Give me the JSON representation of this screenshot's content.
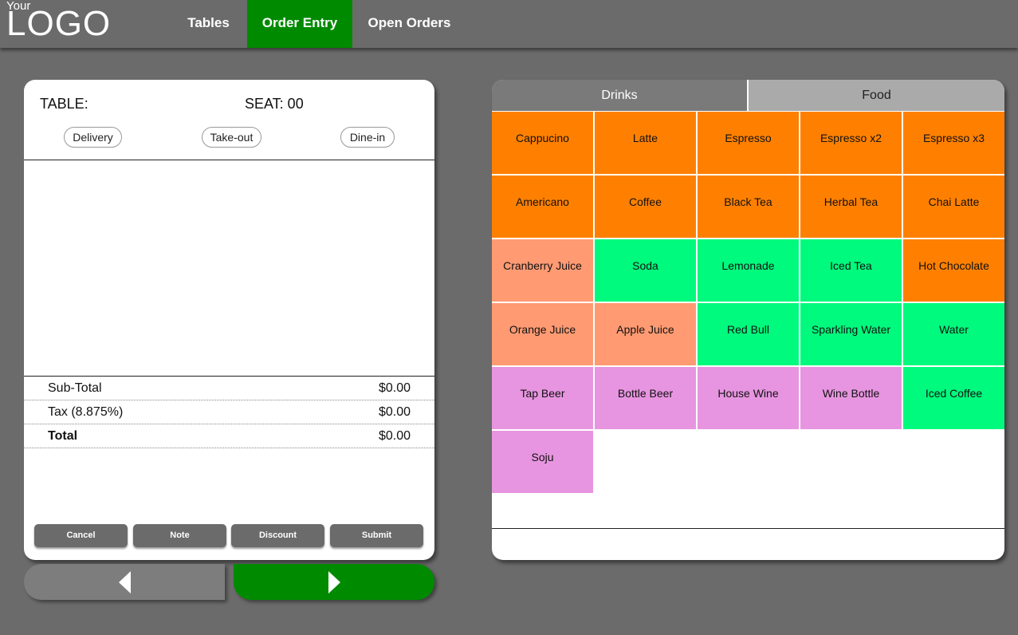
{
  "header": {
    "logo_small": "Your",
    "logo_big": "LOGO",
    "tabs": [
      {
        "label": "Tables"
      },
      {
        "label": "Order Entry",
        "active": true
      },
      {
        "label": "Open Orders"
      }
    ]
  },
  "order": {
    "table_label": "TABLE:",
    "seat_label": "SEAT: 00",
    "service_types": [
      "Delivery",
      "Take-out",
      "Dine-in"
    ],
    "summary": {
      "subtotal_label": "Sub-Total",
      "subtotal_value": "$0.00",
      "tax_label": "Tax (8.875%)",
      "tax_value": "$0.00",
      "total_label": "Total",
      "total_value": "$0.00"
    },
    "actions": [
      "Cancel",
      "Note",
      "Discount",
      "Submit"
    ]
  },
  "pager": {
    "prev_icon": "triangle-left-icon",
    "next_icon": "triangle-right-icon"
  },
  "menu": {
    "tabs": [
      {
        "label": "Drinks",
        "active": true
      },
      {
        "label": "Food"
      }
    ],
    "colors": {
      "hot": "#ff8000",
      "juice": "#ff9a73",
      "cold": "#00fa7d",
      "alcohol": "#e795e0",
      "accent_green": "#008a00"
    },
    "items": [
      {
        "label": "Cappucino",
        "color": "#ff8000"
      },
      {
        "label": "Latte",
        "color": "#ff8000"
      },
      {
        "label": "Espresso",
        "color": "#ff8000"
      },
      {
        "label": "Espresso x2",
        "color": "#ff8000"
      },
      {
        "label": "Espresso x3",
        "color": "#ff8000"
      },
      {
        "label": "Americano",
        "color": "#ff8000"
      },
      {
        "label": "Coffee",
        "color": "#ff8000"
      },
      {
        "label": "Black Tea",
        "color": "#ff8000"
      },
      {
        "label": "Herbal Tea",
        "color": "#ff8000"
      },
      {
        "label": "Chai Latte",
        "color": "#ff8000"
      },
      {
        "label": "Cranberry Juice",
        "color": "#ff9a73"
      },
      {
        "label": "Soda",
        "color": "#00fa7d"
      },
      {
        "label": "Lemonade",
        "color": "#00fa7d"
      },
      {
        "label": "Iced Tea",
        "color": "#00fa7d"
      },
      {
        "label": "Hot Chocolate",
        "color": "#ff8000"
      },
      {
        "label": "Orange Juice",
        "color": "#ff9a73"
      },
      {
        "label": "Apple Juice",
        "color": "#ff9a73"
      },
      {
        "label": "Red Bull",
        "color": "#00fa7d"
      },
      {
        "label": "Sparkling Water",
        "color": "#00fa7d"
      },
      {
        "label": "Water",
        "color": "#00fa7d"
      },
      {
        "label": "Tap Beer",
        "color": "#e795e0"
      },
      {
        "label": "Bottle Beer",
        "color": "#e795e0"
      },
      {
        "label": "House Wine",
        "color": "#e795e0"
      },
      {
        "label": "Wine Bottle",
        "color": "#e795e0"
      },
      {
        "label": "Iced Coffee",
        "color": "#00fa7d"
      },
      {
        "label": "Soju",
        "color": "#e795e0"
      }
    ]
  }
}
